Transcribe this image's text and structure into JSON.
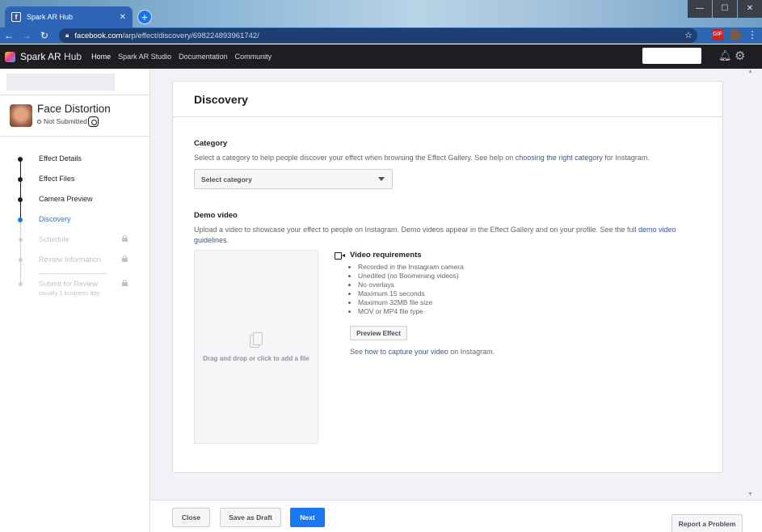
{
  "browser": {
    "tab_title": "Spark AR Hub",
    "tab_close": "✕",
    "new_tab": "+",
    "url_host": "facebook.com",
    "url_path": "/arp/effect/discovery/698224893961742/",
    "window_buttons": [
      "—",
      "☐",
      "✕"
    ],
    "ext_badge": "GIF"
  },
  "topnav": {
    "brand_bold": "Spark AR",
    "brand_light": "Hub",
    "items": [
      "Home",
      "Spark AR Studio",
      "Documentation",
      "Community"
    ],
    "active_index": 0
  },
  "sidebar": {
    "effect_name": "Face Distortion",
    "status": "Not Submitted",
    "steps": [
      {
        "label": "Effect Details",
        "state": "done"
      },
      {
        "label": "Effect Files",
        "state": "done"
      },
      {
        "label": "Camera Preview",
        "state": "done"
      },
      {
        "label": "Discovery",
        "state": "active"
      },
      {
        "label": "Schedule",
        "state": "locked"
      },
      {
        "label": "Review Information",
        "state": "locked"
      },
      {
        "label": "Submit for Review",
        "sublabel": "usually 1 business day",
        "state": "locked"
      }
    ]
  },
  "main": {
    "title": "Discovery",
    "category": {
      "heading": "Category",
      "text_before": "Select a category to help people discover your effect when browsing the Effect Gallery. See help on ",
      "link": "choosing the right category",
      "text_after": " for Instagram.",
      "select_value": "Select category"
    },
    "demo": {
      "heading": "Demo video",
      "text_before": "Upload a video to showcase your effect to people on Instagram. Demo videos appear in the Effect Gallery and on your profile. See the full ",
      "link": "demo video guidelines",
      "text_after": ".",
      "dropzone_text": "Drag and drop or click to add a file",
      "requirements_title": "Video requirements",
      "requirements": [
        "Recorded in the Instagram camera",
        "Unedited (no Boomerang videos)",
        "No overlays",
        "Maximum 15 seconds",
        "Maximum 32MB file size",
        "MOV or MP4 file type"
      ],
      "preview_button": "Preview Effect",
      "see_before": "See ",
      "see_link": "how to capture your video",
      "see_after": " on Instagram."
    }
  },
  "footer": {
    "close": "Close",
    "save_draft": "Save as Draft",
    "next": "Next",
    "report": "Report a Problem"
  },
  "colors": {
    "accent": "#1877f2",
    "link": "#385898",
    "topbar": "#1c1e21"
  }
}
